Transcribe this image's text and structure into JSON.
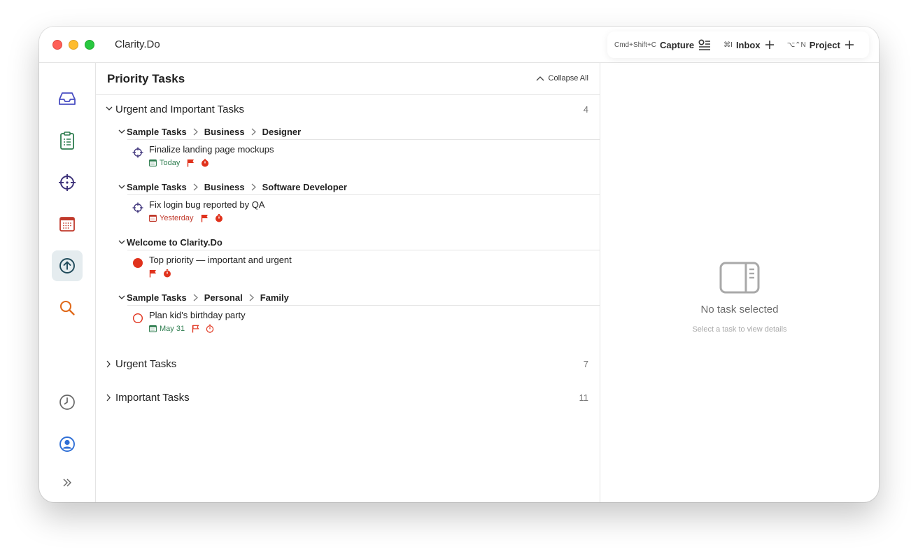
{
  "window": {
    "app_title": "Clarity.Do"
  },
  "quick_actions": [
    {
      "shortcut": "Cmd+Shift+C",
      "label": "Capture",
      "icon": "capture-list-icon"
    },
    {
      "shortcut": "⌘I",
      "label": "Inbox",
      "icon": "plus-icon"
    },
    {
      "shortcut": "⌥⌃N",
      "label": "Project",
      "icon": "plus-icon"
    }
  ],
  "sidebar": {
    "items": [
      {
        "name": "inbox",
        "icon": "inbox-tray-icon",
        "color": "#4a4fc2"
      },
      {
        "name": "tasks",
        "icon": "clipboard-list-icon",
        "color": "#2e7d4f"
      },
      {
        "name": "focus",
        "icon": "crosshair-icon",
        "color": "#3a2f78"
      },
      {
        "name": "calendar",
        "icon": "calendar-icon",
        "color": "#c0392b"
      },
      {
        "name": "priority",
        "icon": "arrow-up-circle-icon",
        "color": "#1f4a5a",
        "active": true
      },
      {
        "name": "search",
        "icon": "search-icon",
        "color": "#e06a1b"
      }
    ],
    "bottom_items": [
      {
        "name": "history",
        "icon": "clock-icon",
        "color": "#666666"
      },
      {
        "name": "account",
        "icon": "user-circle-icon",
        "color": "#2f6fd6"
      },
      {
        "name": "expand",
        "icon": "double-chevron-right-icon",
        "color": "#666666"
      }
    ]
  },
  "main": {
    "title": "Priority Tasks",
    "collapse_all": "Collapse All",
    "groups": [
      {
        "title": "Urgent and Important Tasks",
        "count": "4",
        "expanded": true,
        "sections": [
          {
            "crumbs": [
              "Sample Tasks",
              "Business",
              "Designer"
            ],
            "tasks": [
              {
                "title": "Finalize landing page mockups",
                "status": "focus",
                "date": "Today",
                "date_color": "#2e7d4f",
                "flag": "filled",
                "timer": "filled"
              }
            ]
          },
          {
            "crumbs": [
              "Sample Tasks",
              "Business",
              "Software Developer"
            ],
            "tasks": [
              {
                "title": "Fix login bug reported by QA",
                "status": "focus",
                "date": "Yesterday",
                "date_color": "#c0392b",
                "flag": "filled",
                "timer": "filled"
              }
            ]
          },
          {
            "crumbs": [
              "Welcome to Clarity.Do"
            ],
            "tasks": [
              {
                "title": "Top priority — important and urgent",
                "status": "filled-red",
                "date": "",
                "flag": "filled",
                "timer": "filled"
              }
            ]
          },
          {
            "crumbs": [
              "Sample Tasks",
              "Personal",
              "Family"
            ],
            "tasks": [
              {
                "title": "Plan kid's birthday party",
                "status": "open-red",
                "date": "May 31",
                "date_color": "#2e7d4f",
                "flag": "outline",
                "timer": "outline"
              }
            ]
          }
        ]
      },
      {
        "title": "Urgent Tasks",
        "count": "7",
        "expanded": false
      },
      {
        "title": "Important Tasks",
        "count": "11",
        "expanded": false
      }
    ]
  },
  "detail": {
    "empty_title": "No task selected",
    "empty_subtitle": "Select a task to view details",
    "icon": "sidebar-panel-icon"
  },
  "colors": {
    "accent_red": "#e0321c",
    "active_nav_bg": "#e5ecef"
  }
}
